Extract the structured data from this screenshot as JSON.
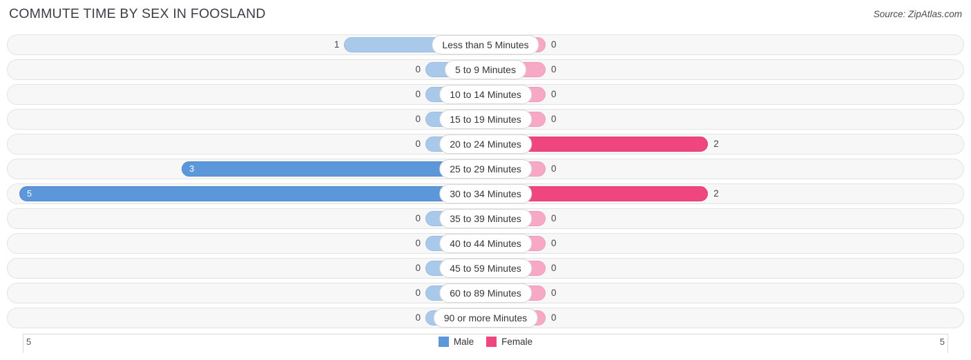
{
  "header": {
    "title": "COMMUTE TIME BY SEX IN FOOSLAND",
    "source": "Source: ZipAtlas.com"
  },
  "legend": {
    "male_label": "Male",
    "female_label": "Female",
    "male_color": "#5b97d9",
    "female_color": "#f0467f"
  },
  "axis": {
    "left_label": "5",
    "right_label": "5"
  },
  "chart_data": {
    "type": "bar",
    "title": "COMMUTE TIME BY SEX IN FOOSLAND",
    "subtitle": "Source: ZipAtlas.com",
    "orientation": "horizontal-diverging",
    "xlabel": "",
    "ylabel": "",
    "xlim": [
      -5,
      5
    ],
    "axis_left_tick": "5",
    "axis_right_tick": "5",
    "grid": false,
    "legend_position": "bottom-center",
    "categories": [
      "Less than 5 Minutes",
      "5 to 9 Minutes",
      "10 to 14 Minutes",
      "15 to 19 Minutes",
      "20 to 24 Minutes",
      "25 to 29 Minutes",
      "30 to 34 Minutes",
      "35 to 39 Minutes",
      "40 to 44 Minutes",
      "45 to 59 Minutes",
      "60 to 89 Minutes",
      "90 or more Minutes"
    ],
    "series": [
      {
        "name": "Male",
        "color": "#5b97d9",
        "values": [
          1,
          0,
          0,
          0,
          0,
          3,
          5,
          0,
          0,
          0,
          0,
          0
        ]
      },
      {
        "name": "Female",
        "color": "#f0467f",
        "values": [
          0,
          0,
          0,
          0,
          2,
          0,
          2,
          0,
          0,
          0,
          0,
          0
        ]
      }
    ]
  },
  "rows": [
    {
      "category": "Less than 5 Minutes",
      "male": "1",
      "female": "0"
    },
    {
      "category": "5 to 9 Minutes",
      "male": "0",
      "female": "0"
    },
    {
      "category": "10 to 14 Minutes",
      "male": "0",
      "female": "0"
    },
    {
      "category": "15 to 19 Minutes",
      "male": "0",
      "female": "0"
    },
    {
      "category": "20 to 24 Minutes",
      "male": "0",
      "female": "2"
    },
    {
      "category": "25 to 29 Minutes",
      "male": "3",
      "female": "0"
    },
    {
      "category": "30 to 34 Minutes",
      "male": "5",
      "female": "2"
    },
    {
      "category": "35 to 39 Minutes",
      "male": "0",
      "female": "0"
    },
    {
      "category": "40 to 44 Minutes",
      "male": "0",
      "female": "0"
    },
    {
      "category": "45 to 59 Minutes",
      "male": "0",
      "female": "0"
    },
    {
      "category": "60 to 89 Minutes",
      "male": "0",
      "female": "0"
    },
    {
      "category": "90 or more Minutes",
      "male": "0",
      "female": "0"
    }
  ]
}
